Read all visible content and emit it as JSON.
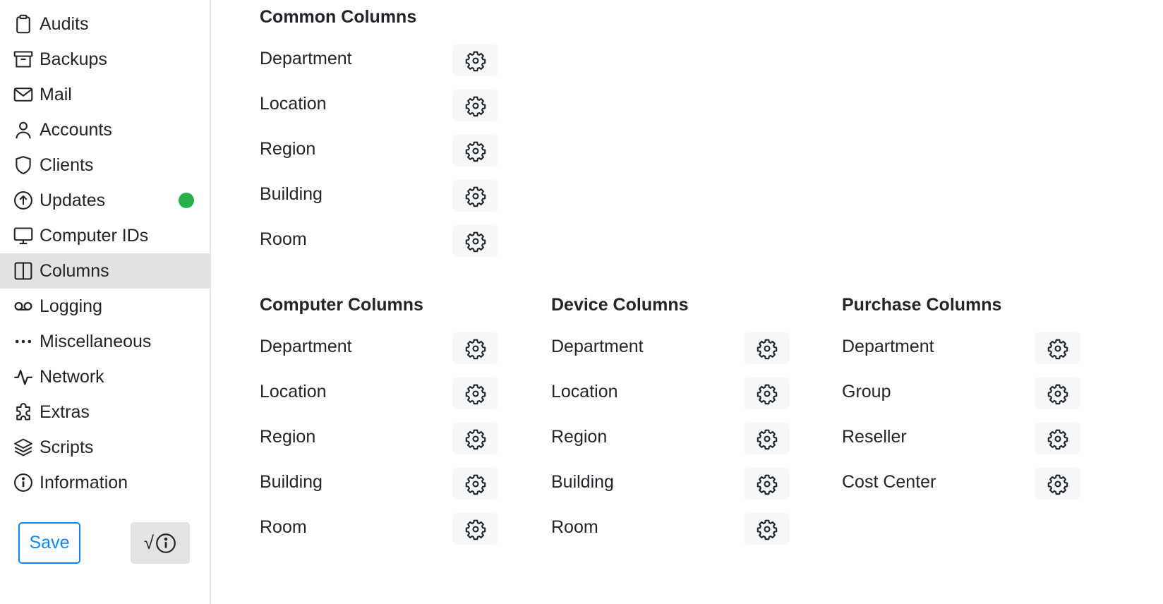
{
  "sidebar": {
    "items": [
      {
        "label": "Audits",
        "icon": "clipboard-icon"
      },
      {
        "label": "Backups",
        "icon": "archive-icon"
      },
      {
        "label": "Mail",
        "icon": "envelope-icon"
      },
      {
        "label": "Accounts",
        "icon": "person-icon"
      },
      {
        "label": "Clients",
        "icon": "shield-icon"
      },
      {
        "label": "Updates",
        "icon": "arrow-up-circle-icon",
        "status_dot": true
      },
      {
        "label": "Computer IDs",
        "icon": "display-icon"
      },
      {
        "label": "Columns",
        "icon": "layout-split-icon",
        "active": true
      },
      {
        "label": "Logging",
        "icon": "voicemail-icon"
      },
      {
        "label": "Miscellaneous",
        "icon": "three-dots-icon"
      },
      {
        "label": "Network",
        "icon": "activity-icon"
      },
      {
        "label": "Extras",
        "icon": "puzzle-icon"
      },
      {
        "label": "Scripts",
        "icon": "layers-icon"
      },
      {
        "label": "Information",
        "icon": "info-circle-icon"
      }
    ],
    "status_dot_color": "#28b04a",
    "save_label": "Save",
    "check_info_label": "√"
  },
  "colors": {
    "accent": "#0d84ff",
    "active_bg": "#e2e2e2",
    "gear_button_bg": "#f7f8fa"
  },
  "sections": {
    "common": {
      "title": "Common Columns",
      "items": [
        "Department",
        "Location",
        "Region",
        "Building",
        "Room"
      ]
    },
    "computer": {
      "title": "Computer Columns",
      "items": [
        "Department",
        "Location",
        "Region",
        "Building",
        "Room"
      ]
    },
    "device": {
      "title": "Device Columns",
      "items": [
        "Department",
        "Location",
        "Region",
        "Building",
        "Room"
      ]
    },
    "purchase": {
      "title": "Purchase Columns",
      "items": [
        "Department",
        "Group",
        "Reseller",
        "Cost Center"
      ]
    }
  }
}
